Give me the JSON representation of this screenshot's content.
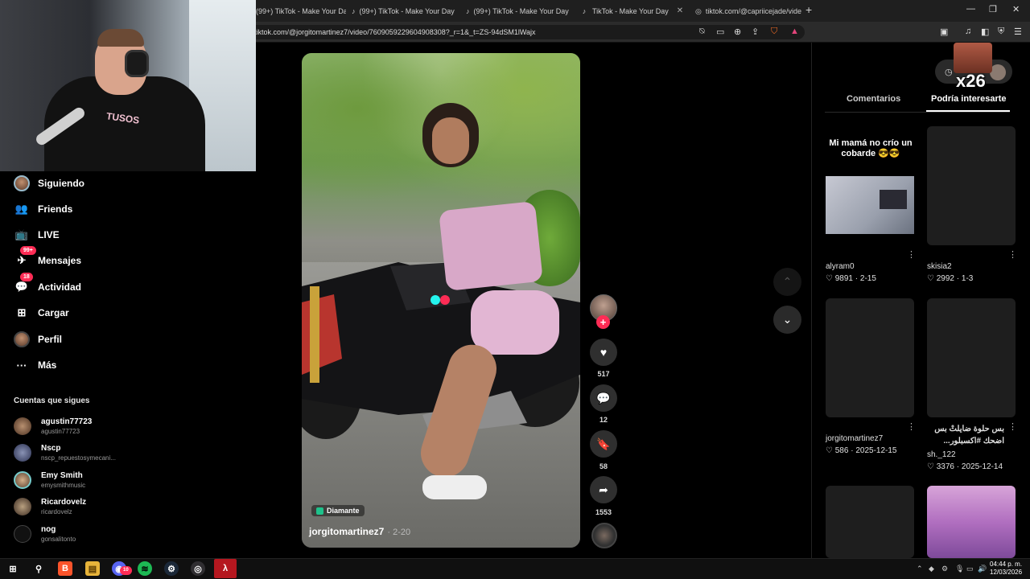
{
  "browser": {
    "tabs": [
      {
        "title": "(99+) TikTok - Make Your Day"
      },
      {
        "title": "(99+) TikTok - Make Your Day"
      },
      {
        "title": "(99+) TikTok - Make Your Day"
      },
      {
        "title": "TikTok - Make Your Day"
      },
      {
        "title": "tiktok.com/@capriicejade/vide"
      }
    ],
    "url": "tiktok.com/@jorgitomartinez7/video/7609059229604908308?_r=1&_t=ZS-94dSM1lWajx"
  },
  "webcam": {
    "shirt_text": "TUSOS"
  },
  "sidebar": {
    "nav": [
      {
        "label": "Siguiendo",
        "icon": "avatar"
      },
      {
        "label": "Friends",
        "icon": "friends-icon"
      },
      {
        "label": "LIVE",
        "icon": "live-tv-icon"
      },
      {
        "label": "Mensajes",
        "icon": "message-icon",
        "badge": "99+"
      },
      {
        "label": "Actividad",
        "icon": "activity-icon",
        "badge": "18"
      },
      {
        "label": "Cargar",
        "icon": "upload-icon"
      },
      {
        "label": "Perfil",
        "icon": "avatar"
      },
      {
        "label": "Más",
        "icon": "more-icon"
      }
    ],
    "following_title": "Cuentas que sigues",
    "following": [
      {
        "name": "agustin77723",
        "handle": "agustin77723"
      },
      {
        "name": "Nscp",
        "handle": "nscp_repuestosymecani..."
      },
      {
        "name": "Emy Smith",
        "handle": "emysmithmusic"
      },
      {
        "name": "Ricardovelz",
        "handle": "ricardovelz"
      },
      {
        "name": "nog",
        "handle": "gonsalitonto"
      }
    ]
  },
  "video": {
    "badge": "Diamante",
    "author": "jorgitomartinez7",
    "date": "2-20"
  },
  "actions": {
    "likes": "517",
    "comments": "12",
    "saves": "58",
    "shares": "1553",
    "follow_plus": "+"
  },
  "right_panel": {
    "overlay_count": "x26",
    "tabs": [
      "Comentarios",
      "Podría interesarte"
    ],
    "cards": [
      {
        "caption": "Mi mamá no crío un cobarde 😎😎",
        "user": "alyram0",
        "likes": "9891",
        "date": "2-15"
      },
      {
        "caption": "",
        "user": "skisia2",
        "likes": "2992",
        "date": "1-3"
      },
      {
        "caption": "",
        "user": "jorgitomartinez7",
        "likes": "586",
        "date": "2025-12-15"
      },
      {
        "caption": "بس حلوة ضايلتْ بس اضحك #اكسبلور...",
        "user": "sh._122",
        "likes": "3376",
        "date": "2025-12-14"
      }
    ]
  },
  "taskbar": {
    "time": "04:44 p. m.",
    "date": "12/03/2026",
    "notification_count": "10"
  }
}
